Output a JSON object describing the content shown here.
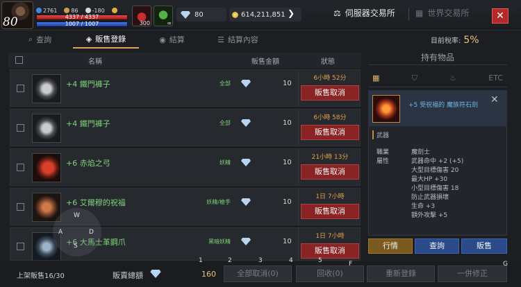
{
  "player": {
    "level": "80",
    "stat_a": "2761",
    "stat_b": "86",
    "stat_c": "-180",
    "hp_text": "4337 / 4337",
    "mp_text": "1007 / 1007",
    "hp_fill": 1.0,
    "mp_fill": 1.0
  },
  "buffs": [
    {
      "name": "potion-buff-icon",
      "count": "300"
    },
    {
      "name": "leaf-buff-icon",
      "count": "∞"
    }
  ],
  "currency": {
    "diamond": "80",
    "gold": "614,211,851"
  },
  "exchange_tabs": {
    "server": "伺服器交易所",
    "world": "世界交易所"
  },
  "subtabs": [
    "查詢",
    "販售登錄",
    "結算",
    "結算內容"
  ],
  "tax": {
    "label": "目前稅率:",
    "value": "5%"
  },
  "list_header": {
    "name": "名稱",
    "price": "販售金額",
    "status": "狀態"
  },
  "listings": [
    {
      "name": "+4 鐵門褲子",
      "tag": "全部",
      "price": "10",
      "time": "6小時 52分",
      "cancel": "販售取消",
      "icon": "pants"
    },
    {
      "name": "+4 鐵門褲子",
      "tag": "全部",
      "price": "10",
      "time": "6小時 58分",
      "cancel": "販售取消",
      "icon": "pants"
    },
    {
      "name": "+6 赤焰之弓",
      "tag": "妖精",
      "price": "10",
      "time": "21小時 13分",
      "cancel": "販售取消",
      "icon": "bow"
    },
    {
      "name": "+6 艾爾穆的祝福",
      "tag": "妖精/槍手",
      "price": "10",
      "time": "1日 7小時",
      "cancel": "販售取消",
      "icon": "shield"
    },
    {
      "name": "+6 大馬士革鋼爪",
      "tag": "黑暗妖精",
      "price": "10",
      "time": "1日 7小時",
      "cancel": "販售取消",
      "icon": "claw"
    }
  ],
  "bottom": {
    "slot_count": "上架販售16/30",
    "total_label": "販賣總額",
    "total_value": "160",
    "cancel_all": "全部取消(0)",
    "recall": "回收(0)",
    "relist": "重新登錄",
    "fix_all": "一併修正"
  },
  "inventory": {
    "title": "持有物品",
    "filters": [
      "",
      "",
      "",
      "ETC"
    ],
    "item_name": "+5 受祝福的 魔族符石劍",
    "item_type": "武器",
    "props": [
      {
        "k": "職業",
        "v": "魔劍士"
      },
      {
        "k": "屬性",
        "v": "武器命中 +2 (+5)"
      },
      {
        "k": "",
        "v": "大型目標傷害 20"
      },
      {
        "k": "",
        "v": "最大HP +30"
      },
      {
        "k": "",
        "v": "小型目標傷害 18"
      },
      {
        "k": "",
        "v": "防止武器損壞"
      },
      {
        "k": "",
        "v": "生命 +3"
      },
      {
        "k": "",
        "v": "額外攻擊 +5"
      }
    ],
    "market_btn": "行情",
    "lookup_btn": "查詢",
    "sell_btn": "販售"
  },
  "hints": {
    "keys": [
      "1",
      "2",
      "3",
      "4",
      "5",
      "F",
      "G"
    ],
    "joystick": [
      "A",
      "W",
      "D",
      "S"
    ]
  },
  "colors": {
    "accent_gold": "#e9c57a",
    "cancel_red": "#8a2424",
    "item_green": "#7fd37a",
    "timer_orange": "#e6a14a",
    "sell_blue": "#2a4a8a"
  }
}
